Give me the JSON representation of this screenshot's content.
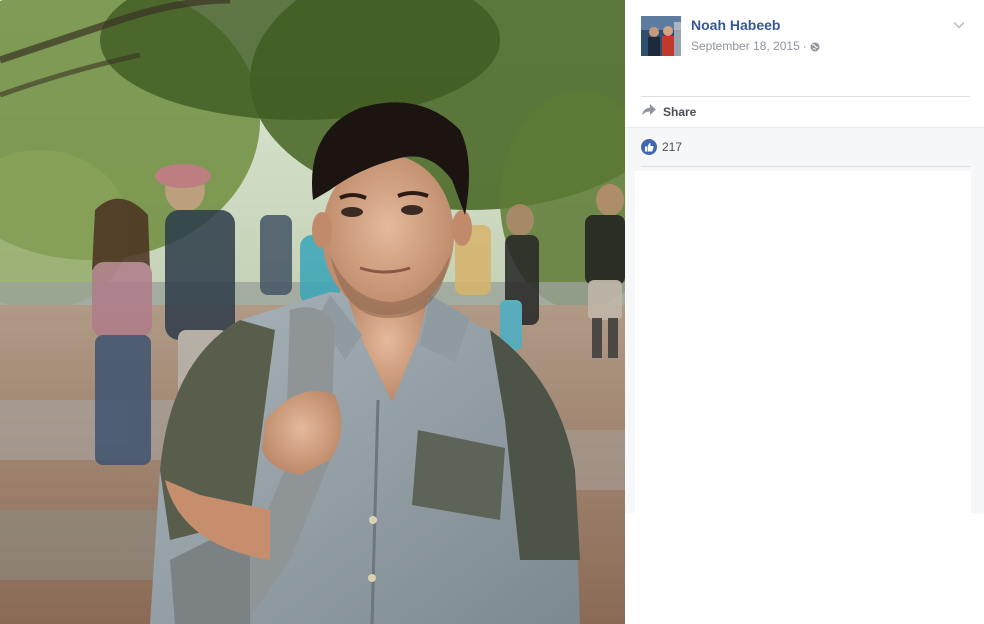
{
  "post": {
    "author_name": "Noah Habeeb",
    "date": "September 18, 2015",
    "separator": "·",
    "privacy_icon": "globe-icon",
    "menu_icon": "chevron-down-icon"
  },
  "actions": {
    "share_label": "Share",
    "share_icon": "share-arrow-icon"
  },
  "reactions": {
    "like_icon": "thumbs-up-icon",
    "like_count": "217"
  },
  "colors": {
    "link_blue": "#365899",
    "like_blue": "#4267b2",
    "meta_gray": "#90949c",
    "panel_bg": "#f6f7f9"
  }
}
